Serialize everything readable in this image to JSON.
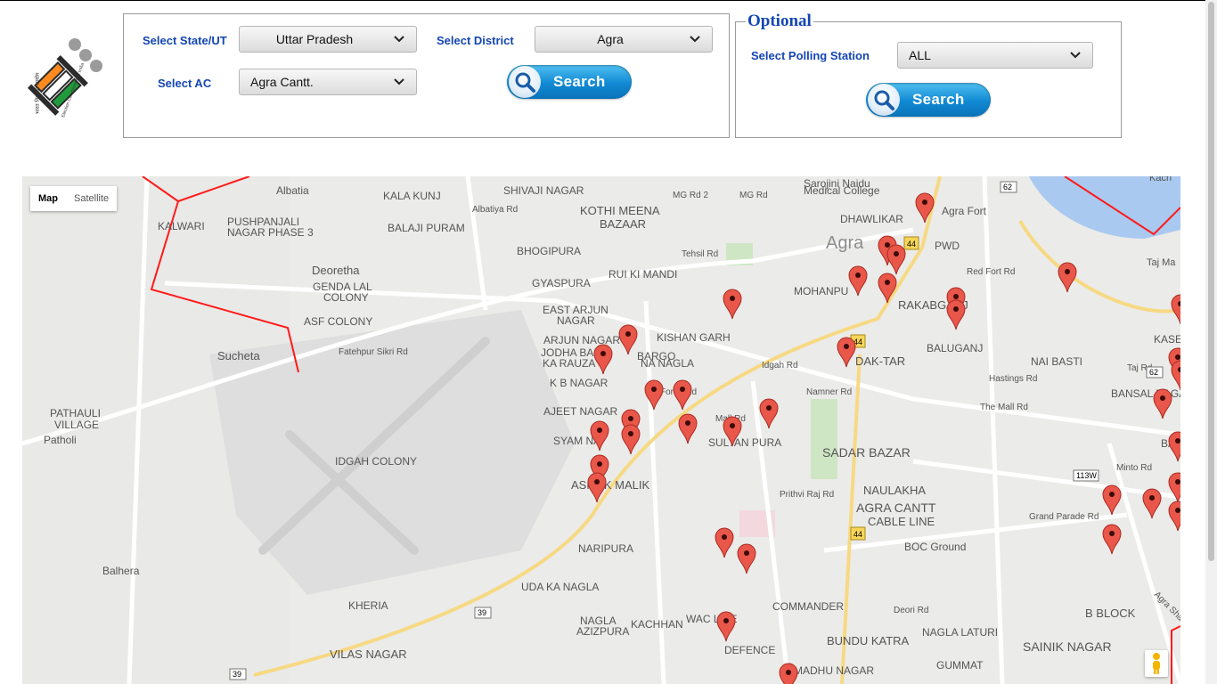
{
  "header": {
    "logo": {
      "name": "Election Commission of India logo",
      "text_hindi": "भारत निर्वाचन आयोग",
      "text_english": "Election Commission of India"
    }
  },
  "filters": {
    "state": {
      "label": "Select State/UT",
      "value": "Uttar Pradesh"
    },
    "district": {
      "label": "Select District",
      "value": "Agra"
    },
    "ac": {
      "label": "Select AC",
      "value": "Agra Cantt."
    },
    "search_label": "Search"
  },
  "optional": {
    "legend": "Optional",
    "polling_station": {
      "label": "Select Polling Station",
      "value": "ALL"
    },
    "search_label": "Search"
  },
  "map": {
    "type_controls": {
      "map": "Map",
      "satellite": "Satellite",
      "active": "Map"
    },
    "labels": [
      "Albatia",
      "KALA KUNJ",
      "SHIVAJI NAGAR",
      "KOTHI MEENA",
      "BAZAAR",
      "Sarojini Naidu",
      "Medical College",
      "MG Rd 2",
      "MG Rd",
      "DHAWLIKAR",
      "Agra Fort",
      "Agra",
      "PWD",
      "Taj Ma",
      "Kach",
      "KALWARI",
      "PUSHPANJALI",
      "NAGAR PHASE 3",
      "BALAJI PURAM",
      "Albatiya Rd",
      "Tehsil Rd",
      "BHOGIPURA",
      "RUI KI MANDI",
      "Red Fort Rd",
      "Deoretha",
      "GENDA LAL",
      "COLONY",
      "GYASPURA",
      "MOHANPU",
      "RAKABGANJ",
      "ASF COLONY",
      "EAST ARJUN",
      "NAGAR",
      "KISHAN GARH",
      "BALUGANJ",
      "KASE",
      "Fatehpur Sikri Rd",
      "ARJUN NAGAR",
      "JODHA BAI",
      "KA RAUZA",
      "BARGO",
      "NA NAGLA",
      "Idgah Rd",
      "DAK-TAR",
      "NAI BASTI",
      "Sucheta",
      "K B NAGAR",
      "Namner Rd",
      "Hastings Rd",
      "Taj Rd",
      "BANSAL NAGA",
      "PATHAULI",
      "VILLAGE",
      "Patholi",
      "Force Rd",
      "AJEET NAGAR",
      "Mall Rd",
      "The Mall Rd",
      "SYAM NA",
      "SULTAN PURA",
      "SADAR BAZAR",
      "BAGI",
      "IDGAH COLONY",
      "ASHOK MALIK",
      "Prithvi Raj Rd",
      "NAULAKHA",
      "AGRA CANTT",
      "CABLE LINE",
      "Grand Parade Rd",
      "Minto Rd",
      "NARIPURA",
      "BOC Ground",
      "Balhera",
      "UDA KA NAGLA",
      "KHERIA",
      "NAGLA",
      "AZIZPURA",
      "KACHHAN",
      "WAC LINE",
      "DEFENCE",
      "COMMANDER",
      "Deori Rd",
      "BUNDU KATRA",
      "NAGLA LATURI",
      "B BLOCK",
      "SAINIK NAGAR",
      "VILAS NAGAR",
      "MADHU NAGAR",
      "GUMMAT",
      "Agra Sha"
    ],
    "shields": [
      "62",
      "44",
      "44",
      "44",
      "62",
      "113W",
      "39",
      "39"
    ],
    "marker_count": 46
  },
  "colors": {
    "label_blue": "#1446b4",
    "boundary_red": "#ff0000",
    "marker_red": "#e8574a",
    "button_blue": "#1189d3"
  }
}
